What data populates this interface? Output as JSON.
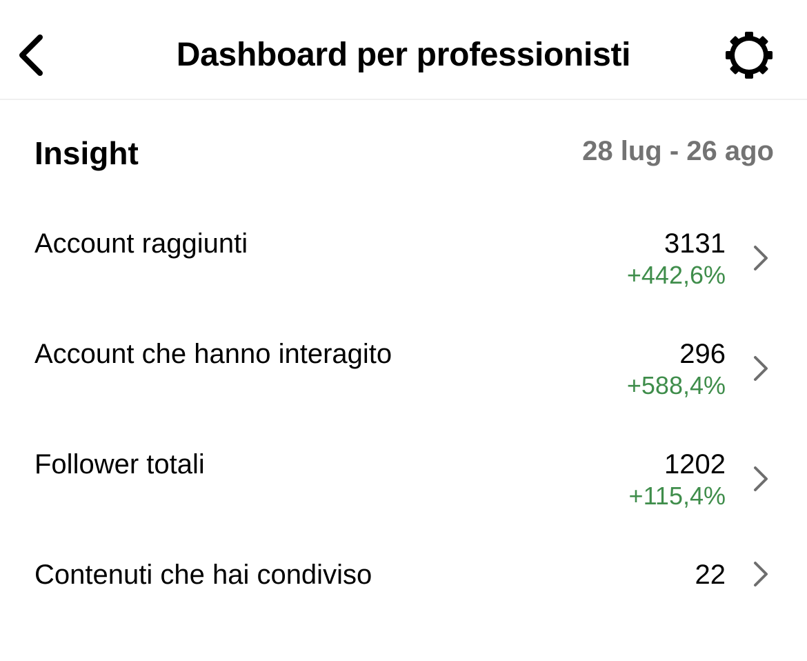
{
  "header": {
    "title": "Dashboard per professionisti",
    "back_icon": "chevron-left-icon",
    "settings_icon": "gear-icon"
  },
  "insight": {
    "title": "Insight",
    "date_range": "28 lug - 26 ago"
  },
  "metrics": [
    {
      "label": "Account raggiunti",
      "value": "3131",
      "change": "+442,6%"
    },
    {
      "label": "Account che hanno interagito",
      "value": "296",
      "change": "+588,4%"
    },
    {
      "label": "Follower totali",
      "value": "1202",
      "change": "+115,4%"
    },
    {
      "label": "Contenuti che hai condiviso",
      "value": "22",
      "change": ""
    }
  ],
  "colors": {
    "positive_change": "#3f8d4b",
    "secondary_text": "#737373",
    "chevron": "#6e6e6e"
  }
}
